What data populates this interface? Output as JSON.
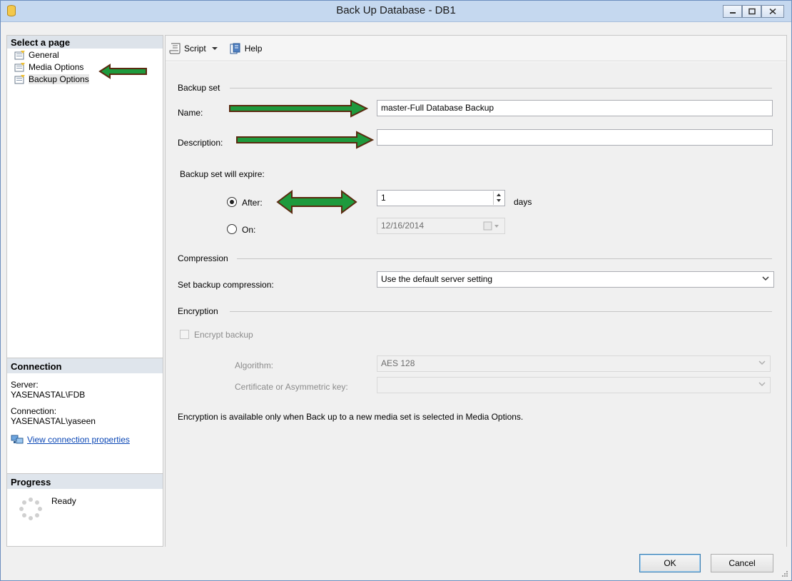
{
  "window": {
    "title": "Back Up Database - DB1"
  },
  "left": {
    "select_page_header": "Select a page",
    "pages": [
      {
        "label": "General"
      },
      {
        "label": "Media Options"
      },
      {
        "label": "Backup Options"
      }
    ],
    "connection_header": "Connection",
    "server_label": "Server:",
    "server_value": "YASENASTAL\\FDB",
    "connection_label": "Connection:",
    "connection_value": "YASENASTAL\\yaseen",
    "view_connection_link": "View connection properties",
    "progress_header": "Progress",
    "progress_status": "Ready"
  },
  "toolbar": {
    "script_label": "Script",
    "help_label": "Help"
  },
  "backup_set": {
    "group_title": "Backup set",
    "name_label": "Name:",
    "name_value": "master-Full Database Backup",
    "description_label": "Description:",
    "description_value": "",
    "expire_label": "Backup set will expire:",
    "after_label": "After:",
    "after_value": "1",
    "days_label": "days",
    "on_label": "On:",
    "on_value": "12/16/2014"
  },
  "compression": {
    "group_title": "Compression",
    "set_label": "Set backup compression:",
    "selected": "Use the default server setting"
  },
  "encryption": {
    "group_title": "Encryption",
    "encrypt_label": "Encrypt backup",
    "algorithm_label": "Algorithm:",
    "algorithm_value": "AES 128",
    "certificate_label": "Certificate or Asymmetric key:",
    "certificate_value": "",
    "note": "Encryption is available only when Back up to a new media set is selected in Media Options."
  },
  "buttons": {
    "ok": "OK",
    "cancel": "Cancel"
  },
  "colors": {
    "arrow_fill": "#1e9a3d",
    "arrow_stroke": "#5a2a10",
    "link": "#0b47b5"
  }
}
